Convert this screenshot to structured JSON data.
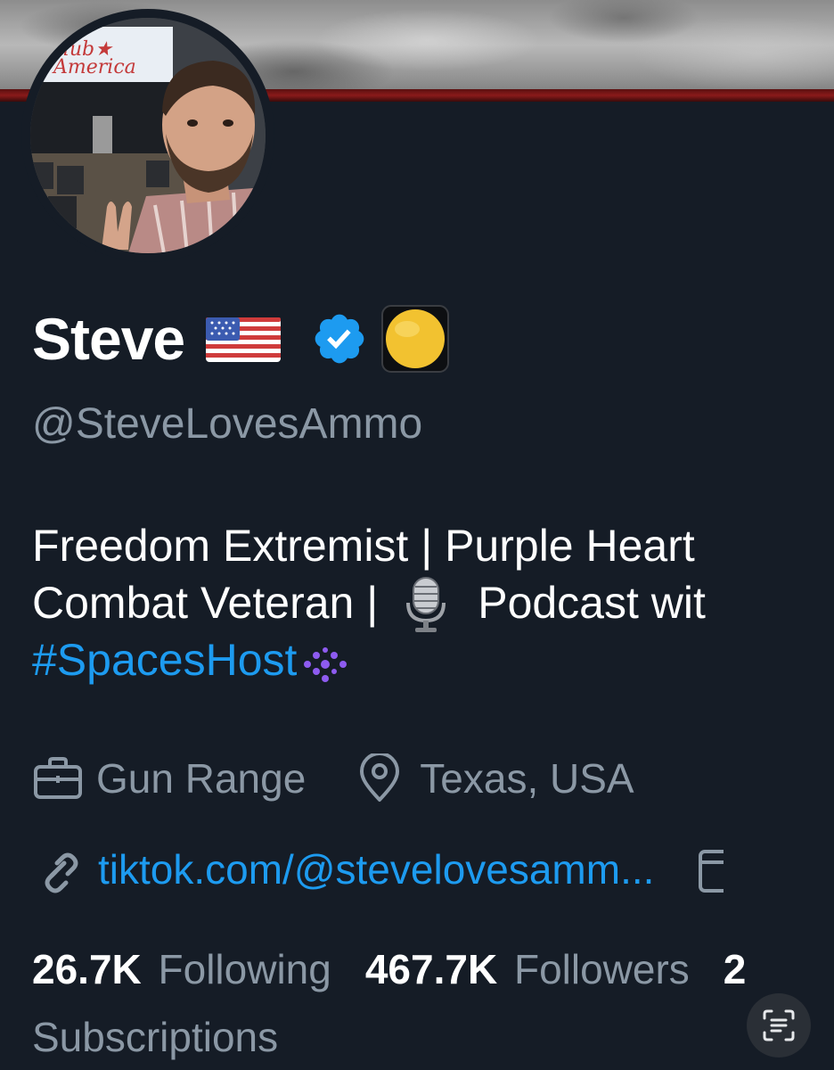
{
  "profile": {
    "display_name": "Steve",
    "handle": "@SteveLovesAmmo",
    "avatar_banner_text": "Club America",
    "bio": {
      "line1": "Freedom Extremist | Purple Heart",
      "line2_a": "Combat Veteran |",
      "line2_b": "Podcast wit",
      "hashtag": "#SpacesHost"
    },
    "meta": {
      "profession": "Gun Range",
      "location": "Texas, USA",
      "link": "tiktok.com/@stevelovesamm..."
    },
    "stats": {
      "following_count": "26.7K",
      "following_label": "Following",
      "followers_count": "467.7K",
      "followers_label": "Followers",
      "extra_count": "2",
      "subscriptions_label": "Subscriptions"
    }
  },
  "icons": {
    "flag": "us-flag-icon",
    "verified": "verified-badge-icon",
    "affiliate": "affiliate-badge-icon",
    "microphone": "microphone-icon",
    "sparkle": "sparkle-icon",
    "briefcase": "briefcase-icon",
    "location": "location-pin-icon",
    "link": "link-icon",
    "calendar": "calendar-icon",
    "scan": "scan-text-icon"
  },
  "colors": {
    "background": "#151c26",
    "accent": "#1d9bf0",
    "muted_text": "#8b98a5",
    "verified": "#1d9bf0",
    "affiliate_gold": "#f2c230"
  }
}
